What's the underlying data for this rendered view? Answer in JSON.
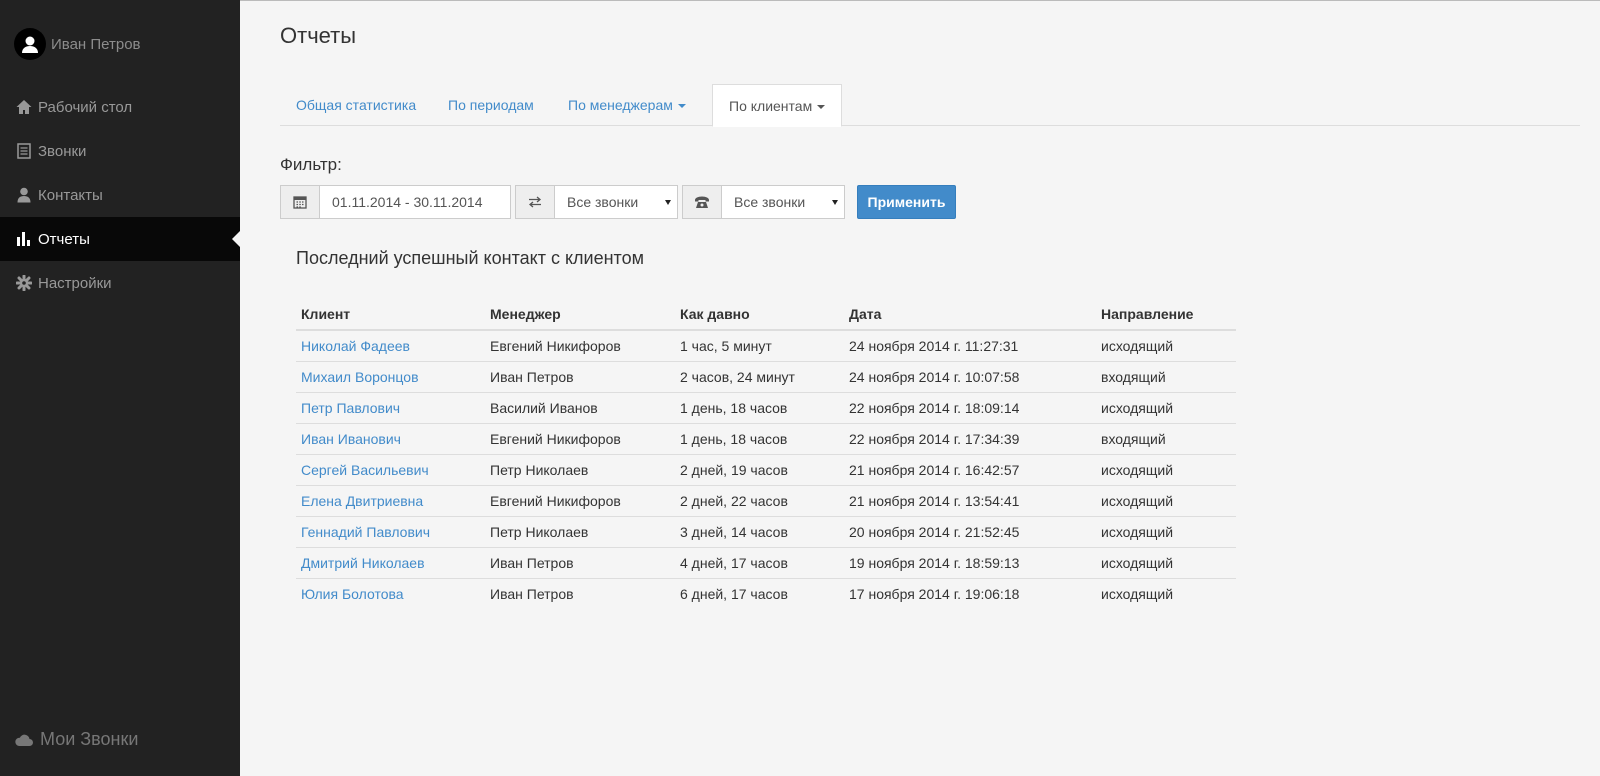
{
  "user": {
    "name": "Иван Петров"
  },
  "nav": {
    "items": [
      {
        "label": "Рабочий стол",
        "icon": "home-icon"
      },
      {
        "label": "Звонки",
        "icon": "list-icon"
      },
      {
        "label": "Контакты",
        "icon": "user-icon"
      },
      {
        "label": "Отчеты",
        "icon": "bar-chart-icon",
        "active": true
      },
      {
        "label": "Настройки",
        "icon": "gear-icon"
      }
    ]
  },
  "brand": {
    "label": "Мои Звонки",
    "icon": "cloud-icon"
  },
  "page": {
    "title": "Отчеты"
  },
  "tabs": [
    {
      "label": "Общая статистика"
    },
    {
      "label": "По периодам"
    },
    {
      "label": "По менеджерам",
      "dropdown": true
    },
    {
      "label": "По клиентам",
      "dropdown": true,
      "active": true
    }
  ],
  "filter": {
    "label": "Фильтр:",
    "date_range": "01.11.2014 - 30.11.2014",
    "direction_select": "Все звонки",
    "status_select": "Все звонки",
    "apply_label": "Применить"
  },
  "report": {
    "title": "Последний успешный контакт с клиентом",
    "columns": [
      "Клиент",
      "Менеджер",
      "Как давно",
      "Дата",
      "Направление"
    ],
    "rows": [
      [
        "Николай Фадеев",
        "Евгений Никифоров",
        "1 час, 5 минут",
        "24 ноября 2014 г. 11:27:31",
        "исходящий"
      ],
      [
        "Михаил Воронцов",
        "Иван Петров",
        "2 часов, 24 минут",
        "24 ноября 2014 г. 10:07:58",
        "входящий"
      ],
      [
        "Петр Павлович",
        "Василий Иванов",
        "1 день, 18 часов",
        "22 ноября 2014 г. 18:09:14",
        "исходящий"
      ],
      [
        "Иван Иванович",
        "Евгений Никифоров",
        "1 день, 18 часов",
        "22 ноября 2014 г. 17:34:39",
        "входящий"
      ],
      [
        "Сергей Васильевич",
        "Петр Николаев",
        "2 дней, 19 часов",
        "21 ноября 2014 г. 16:42:57",
        "исходящий"
      ],
      [
        "Елена Двитриевна",
        "Евгений Никифоров",
        "2 дней, 22 часов",
        "21 ноября 2014 г. 13:54:41",
        "исходящий"
      ],
      [
        "Геннадий Павлович",
        "Петр Николаев",
        "3 дней, 14 часов",
        "20 ноября 2014 г. 21:52:45",
        "исходящий"
      ],
      [
        "Дмитрий Николаев",
        "Иван Петров",
        "4 дней, 17 часов",
        "19 ноября 2014 г. 18:59:13",
        "исходящий"
      ],
      [
        "Юлия Болотова",
        "Иван Петров",
        "6 дней, 17 часов",
        "17 ноября 2014 г. 19:06:18",
        "исходящий"
      ]
    ]
  },
  "colors": {
    "sidebar": "#222222",
    "link": "#428bca",
    "primary": "#428bca"
  }
}
